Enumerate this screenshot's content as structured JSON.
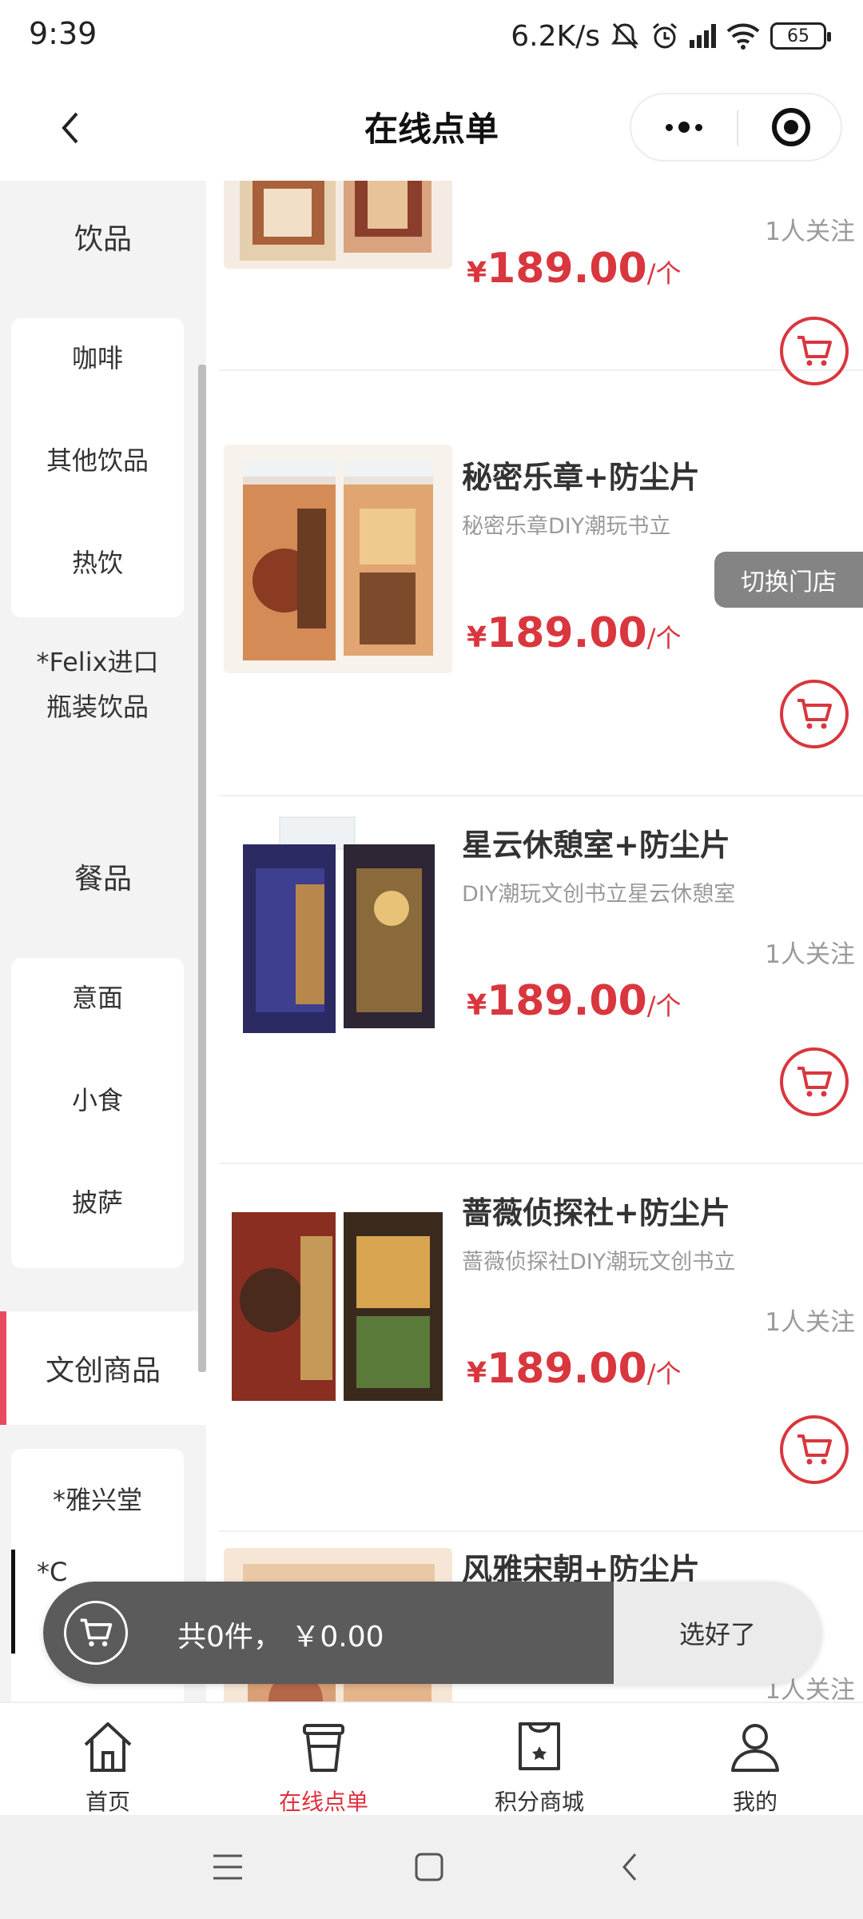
{
  "status_bar": {
    "time": "9:39",
    "network_speed": "6.2K/s",
    "battery": "65"
  },
  "header": {
    "title": "在线点单"
  },
  "sidebar": {
    "categories": [
      {
        "label": "饮品",
        "items": [
          "咖啡",
          "其他饮品",
          "热饮",
          "*Felix进口",
          "瓶装饮品"
        ]
      },
      {
        "label": "餐品",
        "items": [
          "意面",
          "小食",
          "披萨"
        ]
      },
      {
        "label": "文创商品",
        "items": [
          "*雅兴堂",
          "*C"
        ]
      }
    ]
  },
  "products": [
    {
      "name": "",
      "desc": "",
      "follow": "1人关注",
      "price_symbol": "¥",
      "price": "189.00",
      "unit": "/个"
    },
    {
      "name": "秘密乐章+防尘片",
      "desc": "秘密乐章DIY潮玩书立",
      "follow": "",
      "price_symbol": "¥",
      "price": "189.00",
      "unit": "/个"
    },
    {
      "name": "星云休憩室+防尘片",
      "desc": "DIY潮玩文创书立星云休憩室",
      "follow": "1人关注",
      "price_symbol": "¥",
      "price": "189.00",
      "unit": "/个"
    },
    {
      "name": "蔷薇侦探社+防尘片",
      "desc": "蔷薇侦探社DIY潮玩文创书立",
      "follow": "1人关注",
      "price_symbol": "¥",
      "price": "189.00",
      "unit": "/个"
    },
    {
      "name": "风雅宋朝+防尘片",
      "desc": "",
      "follow": "1人关注",
      "price_symbol": "",
      "price": "",
      "unit": ""
    }
  ],
  "switch_store": {
    "label": "切换门店"
  },
  "cart_bar": {
    "summary": "共0件， ￥0.00",
    "checkout_label": "选好了"
  },
  "bottom_nav": {
    "items": [
      {
        "label": "首页",
        "icon": "home-icon"
      },
      {
        "label": "在线点单",
        "icon": "cup-icon"
      },
      {
        "label": "积分商城",
        "icon": "shopping-bag-icon"
      },
      {
        "label": "我的",
        "icon": "user-icon"
      }
    ]
  },
  "colors": {
    "accent_red": "#d9363e",
    "active_nav": "#e0303f",
    "category_marker": "#e84a5f",
    "cart_bar_dark": "#5b5b5b"
  }
}
